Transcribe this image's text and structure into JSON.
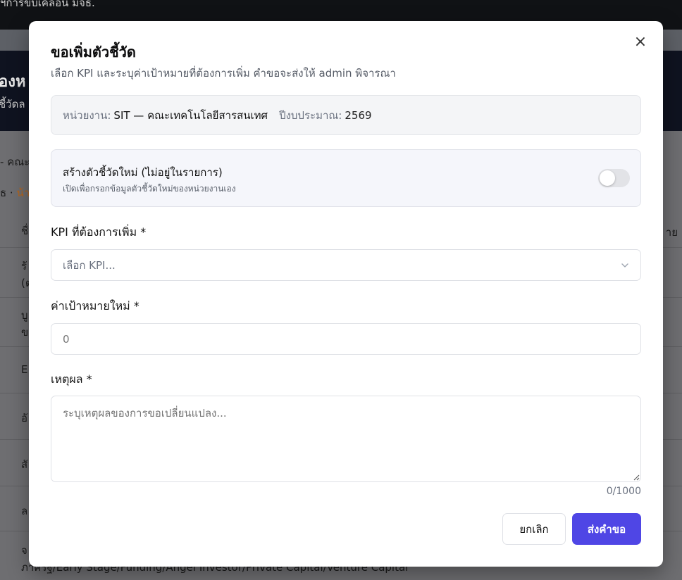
{
  "background": {
    "top_text": "ฯการขับเคลื่อน มจธ.",
    "header_title": "องห",
    "header_sub": "ชี้วัดล",
    "line_1": "- คณะ",
    "line_2_prefix": "ธ · ",
    "line_2_accent": "น้า",
    "column_right": "าย",
    "rows": [
      "ชื่",
      "รั",
      "(ต",
      "บู",
      "ข",
      "E",
      "อั",
      "สั",
      "ล",
      "จ"
    ],
    "bottom_text": "ภาครัฐ/Early Stage/Funding/Angel Investor/Private Capital/Venture Capital"
  },
  "modal": {
    "title": "ขอเพิ่มตัวชี้วัด",
    "subtitle": "เลือก KPI และระบุค่าเป้าหมายที่ต้องการเพิ่ม คำขอจะส่งให้ admin พิจารณา",
    "close_symbol": "×",
    "info": {
      "unit_label": "หน่วยงาน:",
      "unit_value": "SIT — คณะเทคโนโลยีสารสนเทศ",
      "year_label": "ปีงบประมาณ:",
      "year_value": "2569"
    },
    "toggle": {
      "title": "สร้างตัวชี้วัดใหม่ (ไม่อยู่ในรายการ)",
      "description": "เปิดเพื่อกรอกข้อมูลตัวชี้วัดใหม่ของหน่วยงานเอง",
      "on": false
    },
    "kpi_field": {
      "label": "KPI ที่ต้องการเพิ่ม *",
      "placeholder": "เลือก KPI..."
    },
    "target_field": {
      "label": "ค่าเป้าหมายใหม่ *",
      "placeholder": "0"
    },
    "reason_field": {
      "label": "เหตุผล *",
      "placeholder": "ระบุเหตุผลของการขอเปลี่ยนแปลง...",
      "counter": "0/1000"
    },
    "buttons": {
      "cancel": "ยกเลิก",
      "submit": "ส่งคำขอ"
    }
  },
  "colors": {
    "accent": "#4f46e5",
    "overlay": "#6b6b6f"
  }
}
